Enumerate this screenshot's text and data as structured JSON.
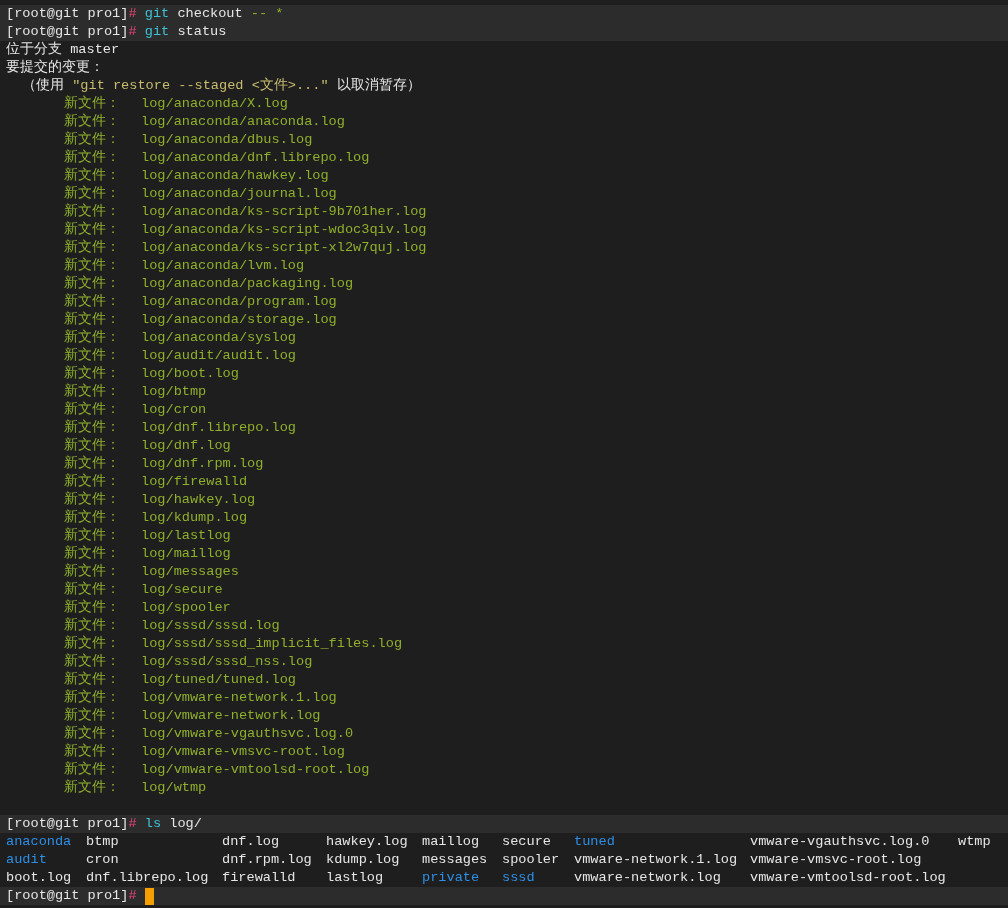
{
  "terminal": {
    "lines": [
      {
        "kind": "prompt",
        "prompt": "[root@git pro1]",
        "symbol": "#",
        "tokens": [
          {
            "kind": "program",
            "text": "git"
          },
          {
            "kind": "word",
            "text": "checkout"
          },
          {
            "kind": "option",
            "text": "-- *"
          }
        ]
      },
      {
        "kind": "prompt",
        "prompt": "[root@git pro1]",
        "symbol": "#",
        "tokens": [
          {
            "kind": "program",
            "text": "git"
          },
          {
            "kind": "word",
            "text": "status"
          }
        ]
      },
      {
        "kind": "text",
        "text": "位于分支 master"
      },
      {
        "kind": "text",
        "text": "要提交的变更："
      },
      {
        "kind": "hint",
        "segments": [
          {
            "kind": "plain",
            "text": "（使用 "
          },
          {
            "kind": "quoted",
            "text": "\"git restore --staged <文件>...\""
          },
          {
            "kind": "plain",
            "text": " 以取消暂存）"
          }
        ]
      },
      {
        "kind": "file",
        "label": "新文件：",
        "path": "log/anaconda/X.log"
      },
      {
        "kind": "file",
        "label": "新文件：",
        "path": "log/anaconda/anaconda.log"
      },
      {
        "kind": "file",
        "label": "新文件：",
        "path": "log/anaconda/dbus.log"
      },
      {
        "kind": "file",
        "label": "新文件：",
        "path": "log/anaconda/dnf.librepo.log"
      },
      {
        "kind": "file",
        "label": "新文件：",
        "path": "log/anaconda/hawkey.log"
      },
      {
        "kind": "file",
        "label": "新文件：",
        "path": "log/anaconda/journal.log"
      },
      {
        "kind": "file",
        "label": "新文件：",
        "path": "log/anaconda/ks-script-9b701her.log"
      },
      {
        "kind": "file",
        "label": "新文件：",
        "path": "log/anaconda/ks-script-wdoc3qiv.log"
      },
      {
        "kind": "file",
        "label": "新文件：",
        "path": "log/anaconda/ks-script-xl2w7quj.log"
      },
      {
        "kind": "file",
        "label": "新文件：",
        "path": "log/anaconda/lvm.log"
      },
      {
        "kind": "file",
        "label": "新文件：",
        "path": "log/anaconda/packaging.log"
      },
      {
        "kind": "file",
        "label": "新文件：",
        "path": "log/anaconda/program.log"
      },
      {
        "kind": "file",
        "label": "新文件：",
        "path": "log/anaconda/storage.log"
      },
      {
        "kind": "file",
        "label": "新文件：",
        "path": "log/anaconda/syslog"
      },
      {
        "kind": "file",
        "label": "新文件：",
        "path": "log/audit/audit.log"
      },
      {
        "kind": "file",
        "label": "新文件：",
        "path": "log/boot.log"
      },
      {
        "kind": "file",
        "label": "新文件：",
        "path": "log/btmp"
      },
      {
        "kind": "file",
        "label": "新文件：",
        "path": "log/cron"
      },
      {
        "kind": "file",
        "label": "新文件：",
        "path": "log/dnf.librepo.log"
      },
      {
        "kind": "file",
        "label": "新文件：",
        "path": "log/dnf.log"
      },
      {
        "kind": "file",
        "label": "新文件：",
        "path": "log/dnf.rpm.log"
      },
      {
        "kind": "file",
        "label": "新文件：",
        "path": "log/firewalld"
      },
      {
        "kind": "file",
        "label": "新文件：",
        "path": "log/hawkey.log"
      },
      {
        "kind": "file",
        "label": "新文件：",
        "path": "log/kdump.log"
      },
      {
        "kind": "file",
        "label": "新文件：",
        "path": "log/lastlog"
      },
      {
        "kind": "file",
        "label": "新文件：",
        "path": "log/maillog"
      },
      {
        "kind": "file",
        "label": "新文件：",
        "path": "log/messages"
      },
      {
        "kind": "file",
        "label": "新文件：",
        "path": "log/secure"
      },
      {
        "kind": "file",
        "label": "新文件：",
        "path": "log/spooler"
      },
      {
        "kind": "file",
        "label": "新文件：",
        "path": "log/sssd/sssd.log"
      },
      {
        "kind": "file",
        "label": "新文件：",
        "path": "log/sssd/sssd_implicit_files.log"
      },
      {
        "kind": "file",
        "label": "新文件：",
        "path": "log/sssd/sssd_nss.log"
      },
      {
        "kind": "file",
        "label": "新文件：",
        "path": "log/tuned/tuned.log"
      },
      {
        "kind": "file",
        "label": "新文件：",
        "path": "log/vmware-network.1.log"
      },
      {
        "kind": "file",
        "label": "新文件：",
        "path": "log/vmware-network.log"
      },
      {
        "kind": "file",
        "label": "新文件：",
        "path": "log/vmware-vgauthsvc.log.0"
      },
      {
        "kind": "file",
        "label": "新文件：",
        "path": "log/vmware-vmsvc-root.log"
      },
      {
        "kind": "file",
        "label": "新文件：",
        "path": "log/vmware-vmtoolsd-root.log"
      },
      {
        "kind": "file",
        "label": "新文件：",
        "path": "log/wtmp"
      },
      {
        "kind": "blank"
      },
      {
        "kind": "prompt",
        "prompt": "[root@git pro1]",
        "symbol": "#",
        "tokens": [
          {
            "kind": "program",
            "text": "ls"
          },
          {
            "kind": "word",
            "text": "log/"
          }
        ]
      },
      {
        "kind": "listing",
        "rows": [
          [
            {
              "kind": "dir",
              "name": "anaconda"
            },
            {
              "kind": "file",
              "name": "btmp"
            },
            {
              "kind": "file",
              "name": "dnf.log"
            },
            {
              "kind": "file",
              "name": "hawkey.log"
            },
            {
              "kind": "file",
              "name": "maillog"
            },
            {
              "kind": "file",
              "name": "secure"
            },
            {
              "kind": "dir",
              "name": "tuned"
            },
            {
              "kind": "file",
              "name": "vmware-vgauthsvc.log.0"
            },
            {
              "kind": "file",
              "name": "wtmp"
            }
          ],
          [
            {
              "kind": "dir",
              "name": "audit"
            },
            {
              "kind": "file",
              "name": "cron"
            },
            {
              "kind": "file",
              "name": "dnf.rpm.log"
            },
            {
              "kind": "file",
              "name": "kdump.log"
            },
            {
              "kind": "file",
              "name": "messages"
            },
            {
              "kind": "file",
              "name": "spooler"
            },
            {
              "kind": "file",
              "name": "vmware-network.1.log"
            },
            {
              "kind": "file",
              "name": "vmware-vmsvc-root.log"
            }
          ],
          [
            {
              "kind": "file",
              "name": "boot.log"
            },
            {
              "kind": "file",
              "name": "dnf.librepo.log"
            },
            {
              "kind": "file",
              "name": "firewalld"
            },
            {
              "kind": "file",
              "name": "lastlog"
            },
            {
              "kind": "dir",
              "name": "private"
            },
            {
              "kind": "dir",
              "name": "sssd"
            },
            {
              "kind": "file",
              "name": "vmware-network.log"
            },
            {
              "kind": "file",
              "name": "vmware-vmtoolsd-root.log"
            }
          ]
        ]
      },
      {
        "kind": "prompt",
        "prompt": "[root@git pro1]",
        "symbol": "#",
        "cursor": true
      }
    ]
  }
}
